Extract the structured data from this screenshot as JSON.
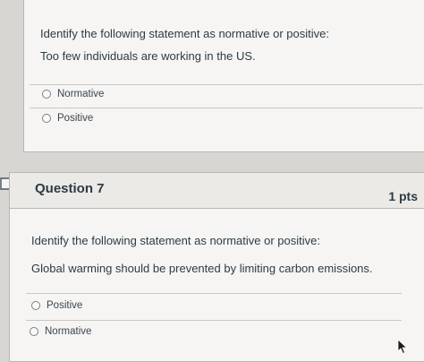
{
  "previous_question": {
    "prompt": "Identify the following statement as normative or positive:",
    "statement": "Too few individuals are working in the US.",
    "options": [
      "Normative",
      "Positive"
    ]
  },
  "question": {
    "title": "Question 7",
    "points": "1 pts",
    "prompt": "Identify the following statement as normative or positive:",
    "statement": "Global warming should be prevented by limiting carbon emissions.",
    "options": [
      "Positive",
      "Normative"
    ]
  },
  "icons": {
    "bookmark": "bookmark-icon",
    "cursor": "mouse-pointer-icon"
  }
}
